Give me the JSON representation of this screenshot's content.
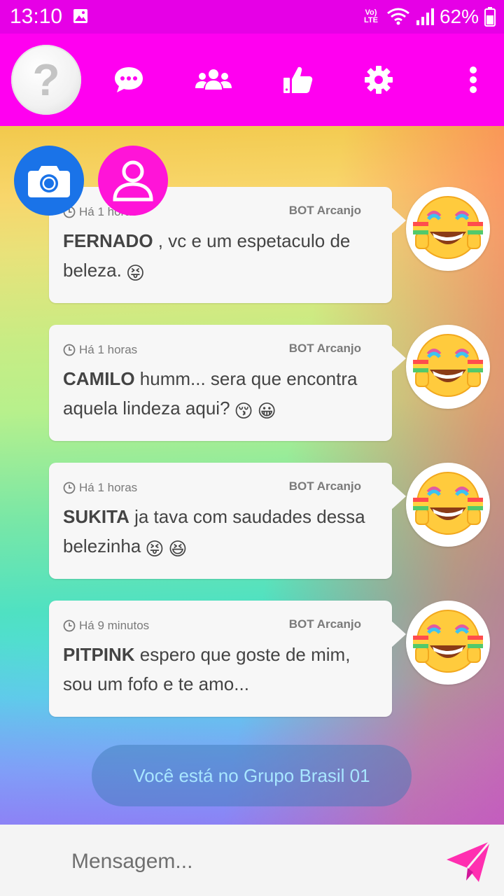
{
  "status_bar": {
    "time": "13:10",
    "volte": "Vo)",
    "lte": "LTE",
    "battery": "62%"
  },
  "header": {
    "avatar_symbol": "?",
    "icons": [
      "chat-icon",
      "group-icon",
      "thumbs-up-icon",
      "gear-icon",
      "more-vert-icon"
    ]
  },
  "fabs": {
    "camera_icon": "camera-icon",
    "profile_icon": "user-icon"
  },
  "messages": [
    {
      "time": "Há 1 horas",
      "sender": "BOT Arcanjo",
      "name": "FERNADO",
      "text": " , vc e um espetaculo de beleza.",
      "emojis": [
        "😝"
      ]
    },
    {
      "time": "Há 1 horas",
      "sender": "BOT Arcanjo",
      "name": "CAMILO",
      "text": " humm... sera que encontra aquela lindeza aqui?",
      "emojis": [
        "😚",
        "😀"
      ]
    },
    {
      "time": "Há 1 horas",
      "sender": "BOT Arcanjo",
      "name": "SUKITA",
      "text": " ja tava com saudades dessa belezinha",
      "emojis": [
        "😝",
        "😆"
      ]
    },
    {
      "time": "Há 9 minutos",
      "sender": "BOT Arcanjo",
      "name": "PITPINK",
      "text": " espero que goste de mim, sou um fofo e te amo...",
      "emojis": []
    }
  ],
  "group_label": "Você está no Grupo Brasil 01",
  "composer": {
    "placeholder": "Mensagem...",
    "send_icon": "send-icon"
  },
  "colors": {
    "status_bar": "#e600e6",
    "header": "#ff00f0",
    "camera_fab": "#1a73e8",
    "profile_fab": "#ff14d8",
    "send": "#ff2fb0"
  }
}
